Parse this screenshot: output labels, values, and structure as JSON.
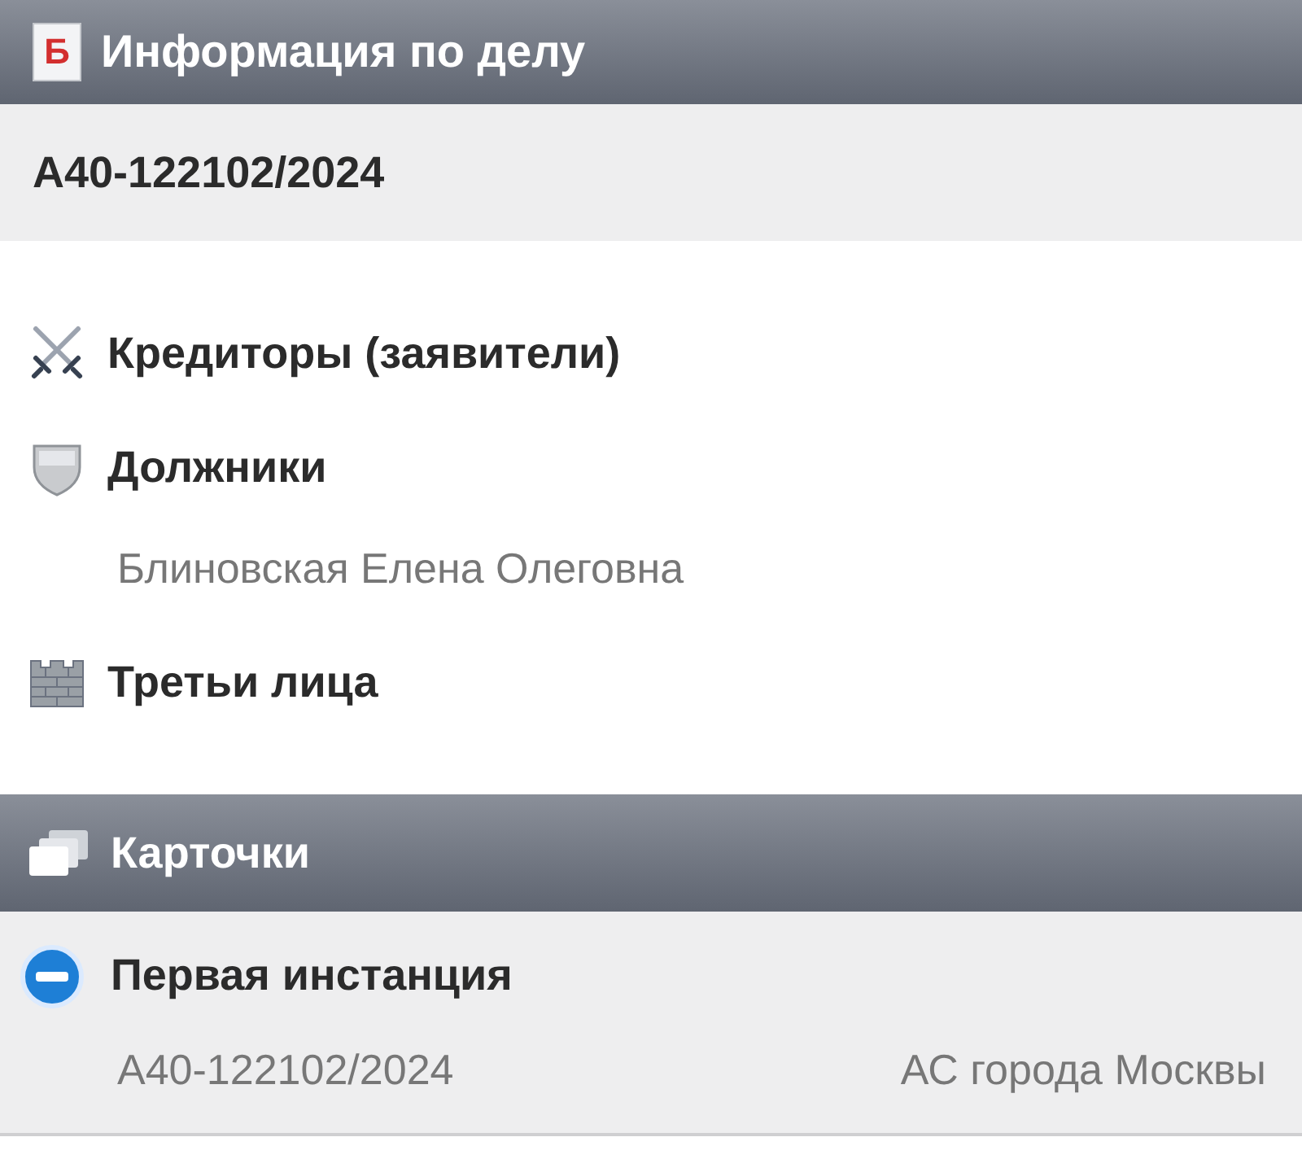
{
  "header": {
    "logo_letter": "Б",
    "title": "Информация по делу"
  },
  "case_number": "А40-122102/2024",
  "parties": [
    {
      "kind": "creditors",
      "label": "Кредиторы (заявители)"
    },
    {
      "kind": "debtors",
      "label": "Должники",
      "names": [
        "Блиновская Елена Олеговна"
      ]
    },
    {
      "kind": "third",
      "label": "Третьи лица"
    }
  ],
  "cards_header": {
    "title": "Карточки"
  },
  "cards": [
    {
      "title": "Первая инстанция",
      "expanded": true,
      "number": "А40-122102/2024",
      "court": "АС города Москвы"
    }
  ]
}
